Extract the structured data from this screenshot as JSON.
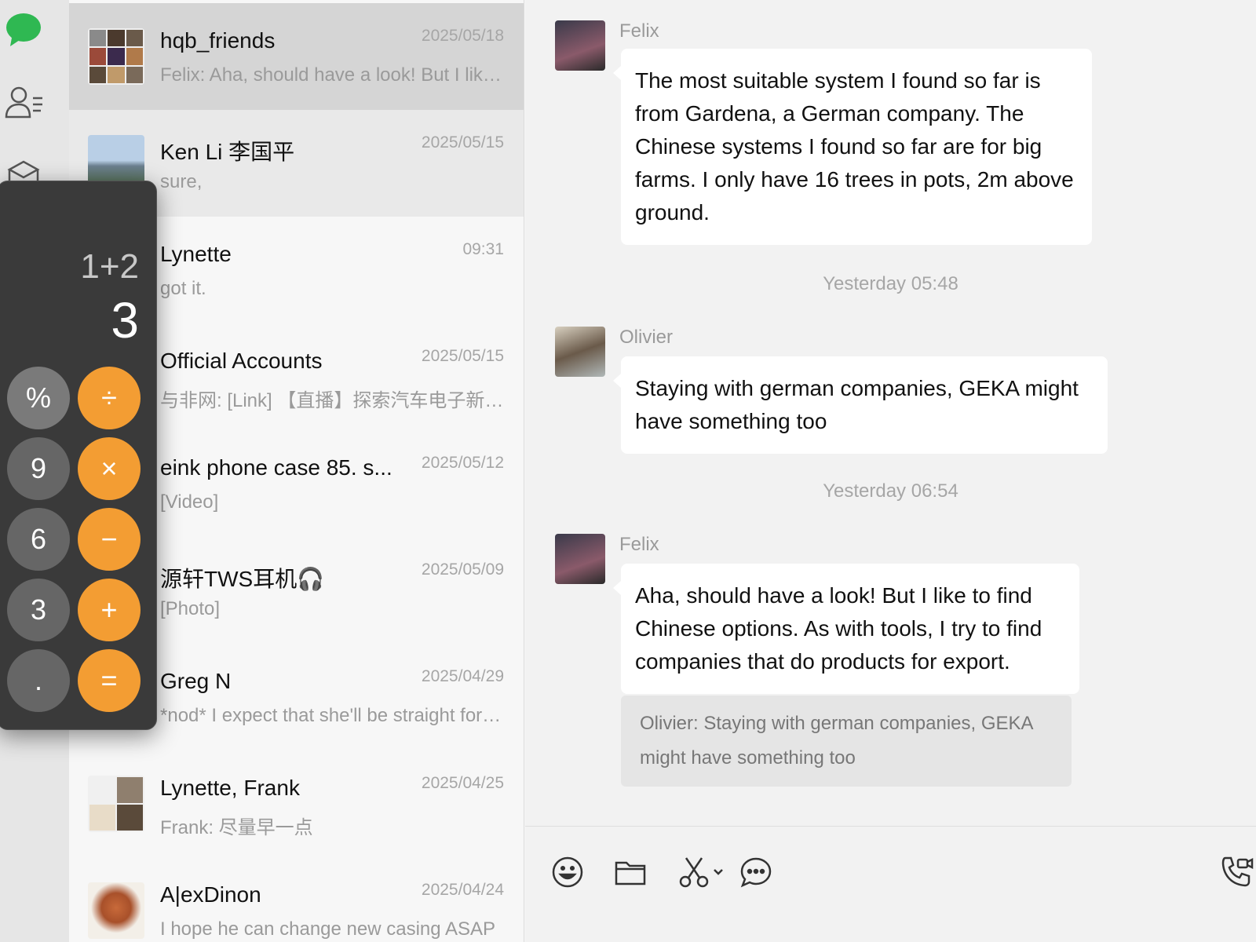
{
  "colors": {
    "wechat_green": "#2fb852",
    "calc_orange": "#f39d33",
    "calc_gray": "#666666",
    "selected_row": "#d5d5d5"
  },
  "rail": {
    "icons": [
      "chat-icon",
      "contacts-icon",
      "box-icon"
    ]
  },
  "conversations": [
    {
      "name": "hqb_friends",
      "preview": "Felix: Aha, should have a look! But I like to find Chinese options.",
      "date": "2025/05/18",
      "state": "selected"
    },
    {
      "name": "Ken Li 李国平",
      "preview": "sure,",
      "date": "2025/05/15",
      "state": "hovered"
    },
    {
      "name": "Lynette",
      "preview": "got it.",
      "date": "09:31",
      "state": ""
    },
    {
      "name": "Official Accounts",
      "preview": "与非网: [Link] 【直播】探索汽车电子新技术",
      "date": "2025/05/15",
      "state": ""
    },
    {
      "name": "eink phone case  85. s...",
      "preview": "[Video]",
      "date": "2025/05/12",
      "state": ""
    },
    {
      "name": "源轩TWS耳机🎧",
      "preview": "[Photo]",
      "date": "2025/05/09",
      "state": ""
    },
    {
      "name": "Greg N",
      "preview": "*nod* I expect that she'll be straight forward",
      "date": "2025/04/29",
      "state": ""
    },
    {
      "name": "Lynette, Frank",
      "preview": "Frank: 尽量早一点",
      "date": "2025/04/25",
      "state": ""
    },
    {
      "name": "A|exDinon",
      "preview": "I hope he can change new casing ASAP",
      "date": "2025/04/24",
      "state": ""
    }
  ],
  "chat": {
    "messages": [
      {
        "sender": "Felix",
        "text": "The most suitable system I found so far is from Gardena, a German company. The Chinese systems I found so far are for big farms. I only have 16 trees in pots, 2m above ground."
      },
      {
        "sender": "Olivier",
        "text": "Staying with german companies, GEKA might have something too"
      },
      {
        "sender": "Felix",
        "text": "Aha, should have a look! But I like to find Chinese options. As with tools, I try to find companies that do products for export."
      }
    ],
    "timestamps": [
      "Yesterday 05:48",
      "Yesterday 06:54"
    ],
    "quote": "Olivier: Staying with german companies, GEKA might have something too"
  },
  "toolbar": {
    "icons": [
      "emoji-icon",
      "folder-icon",
      "scissors-icon",
      "chat-bubble-icon",
      "call-icon"
    ]
  },
  "calculator": {
    "expression": "1+2",
    "result": "3",
    "buttons": [
      "%",
      "÷",
      "9",
      "×",
      "6",
      "−",
      "3",
      "+",
      ".",
      "="
    ]
  }
}
